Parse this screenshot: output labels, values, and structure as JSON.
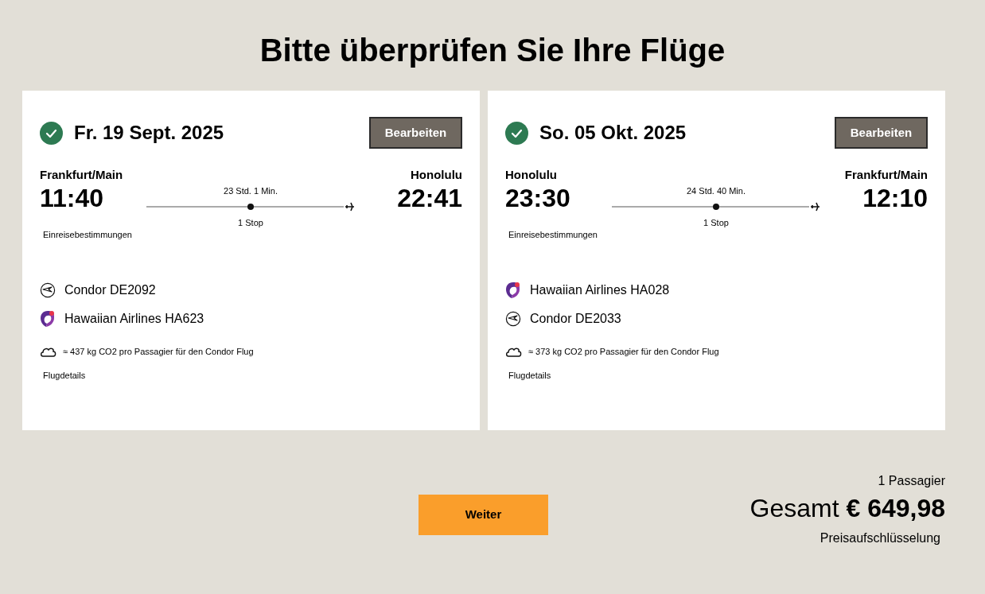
{
  "title": "Bitte überprüfen Sie Ihre Flüge",
  "flights": [
    {
      "date": "Fr. 19 Sept. 2025",
      "confirmed": true,
      "edit_label": "Bearbeiten",
      "origin": "Frankfurt/Main",
      "destination": "Honolulu",
      "departure": "11:40",
      "arrival": "22:41",
      "duration": "23 Std. 1 Min.",
      "stops": "1 Stop",
      "entry_link": "Einreisebestimmungen",
      "airlines": [
        {
          "kind": "condor",
          "label": "Condor DE2092"
        },
        {
          "kind": "hawaiian",
          "label": "Hawaiian Airlines HA623"
        }
      ],
      "co2": "≈ 437 kg CO2 pro Passagier für den Condor Flug",
      "details_link": "Flugdetails"
    },
    {
      "date": "So. 05 Okt. 2025",
      "confirmed": true,
      "edit_label": "Bearbeiten",
      "origin": "Honolulu",
      "destination": "Frankfurt/Main",
      "departure": "23:30",
      "arrival": "12:10",
      "duration": "24 Std. 40 Min.",
      "stops": "1 Stop",
      "entry_link": "Einreisebestimmungen",
      "airlines": [
        {
          "kind": "hawaiian",
          "label": "Hawaiian Airlines HA028"
        },
        {
          "kind": "condor",
          "label": "Condor DE2033"
        }
      ],
      "co2": "≈ 373 kg CO2 pro Passagier für den Condor Flug",
      "details_link": "Flugdetails"
    }
  ],
  "continue_button": "Weiter",
  "summary": {
    "passengers": "1 Passagier",
    "total": "Gesamt **€ 649,98**",
    "breakdown_link": "Preisaufschlüsselung"
  }
}
